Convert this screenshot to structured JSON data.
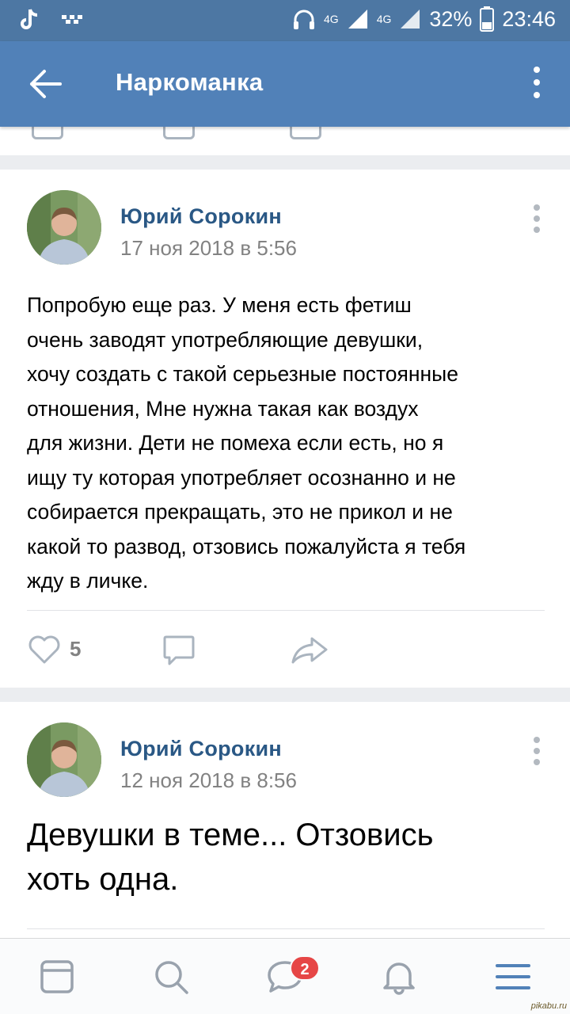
{
  "status_bar": {
    "battery": "32%",
    "time": "23:46",
    "network_1": "4G",
    "network_2": "4G"
  },
  "header": {
    "title": "Наркоманка"
  },
  "posts": [
    {
      "author": "Юрий Сорокин",
      "date": "17 ноя 2018 в 5:56",
      "text_lines": [
        "Попробую еще раз. У меня есть фетиш",
        "очень заводят употребляющие девушки,",
        "хочу создать с такой серьезные постоянные",
        "отношения, Мне нужна такая как воздух",
        "для жизни. Дети не помеха если есть, но я",
        "ищу ту которая употребляет осознанно и не",
        "собирается прекращать, это не прикол и не",
        "какой то развод, отзовись пожалуйста я тебя",
        "жду в личке."
      ],
      "likes": "5"
    },
    {
      "author": "Юрий Сорокин",
      "date": "12 ноя 2018 в 8:56",
      "text_lines": [
        "Девушки в теме... Отзовись",
        "хоть одна."
      ]
    }
  ],
  "tabbar": {
    "messages_badge": "2"
  },
  "watermark": "pikabu.ru",
  "colors": {
    "header": "#5181b8",
    "status_bar": "#4d77a3",
    "link": "#2a5885",
    "badge": "#e64646"
  }
}
